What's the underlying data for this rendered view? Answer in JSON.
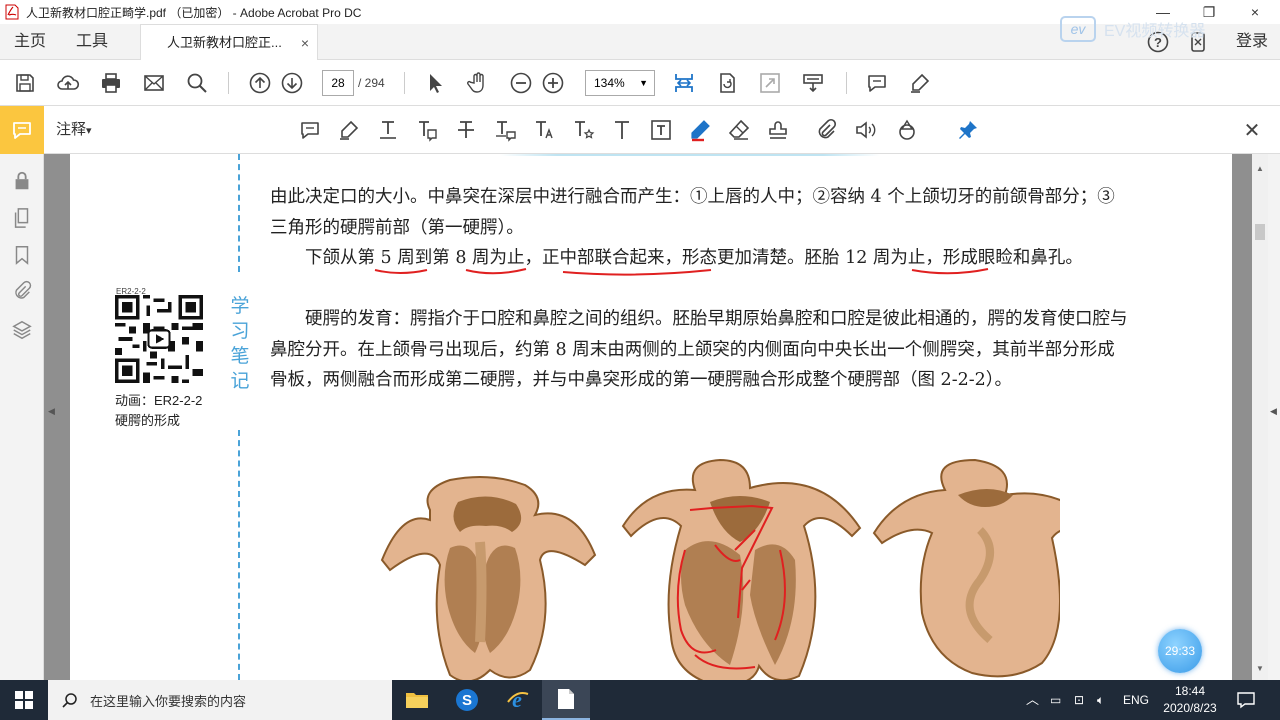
{
  "window": {
    "title": "人卫新教材口腔正畸学.pdf （已加密） - Adobe Acrobat Pro DC",
    "close_glyph": "×",
    "max_glyph": "❐",
    "min_glyph": "—"
  },
  "menubar": {
    "home": "主页",
    "tools": "工具",
    "tab_label": "人卫新教材口腔正...",
    "tab_close": "×",
    "login": "登录"
  },
  "watermark": {
    "badge": "ev",
    "text": "EV视频转换器"
  },
  "toolbar": {
    "page_current": "28",
    "page_total": "/ 294",
    "zoom": "134%",
    "zoom_caret": "▼"
  },
  "annotation_bar": {
    "label": "注释",
    "caret": "▾",
    "close_glyph": "✕"
  },
  "document": {
    "paragraphs": [
      "由此决定口的大小。中鼻突在深层中进行融合而产生：①上唇的人中；②容纳 4 个上颌切牙的前颌骨部分；③三角形的硬腭前部（第一硬腭）。",
      "　　下颌从第 5 周到第 8 周为止，正中部联合起来，形态更加清楚。胚胎 12 周为止，形成眼睑和鼻孔。",
      "　　硬腭的发育：腭指介于口腔和鼻腔之间的组织。胚胎早期原始鼻腔和口腔是彼此相通的，腭的发育使口腔与鼻腔分开。在上颌骨弓出现后，约第 8 周末由两侧的上颌突的内侧面向中央长出一个侧腭突，其前半部分形成骨板，两侧融合而形成第二硬腭，并与中鼻突形成的第一硬腭融合形成整个硬腭部（图 2-2-2）。"
    ],
    "side_notes": [
      "学",
      "习",
      "笔",
      "记"
    ],
    "qr_id": "ER2-2-2",
    "qr_caption_line1": "动画：ER2-2-2",
    "qr_caption_line2": "硬腭的形成"
  },
  "colors": {
    "annotation_accent": "#fbc63f",
    "ink_red": "#e02020",
    "side_note_blue": "#4aa3d8",
    "tissue": "#e3b48f",
    "tissue_border": "#8a5a2a"
  },
  "overlay": {
    "timer": "29:33"
  },
  "taskbar": {
    "search_placeholder": "在这里输入你要搜索的内容",
    "lang": "ENG",
    "time": "18:44",
    "date": "2020/8/23"
  }
}
